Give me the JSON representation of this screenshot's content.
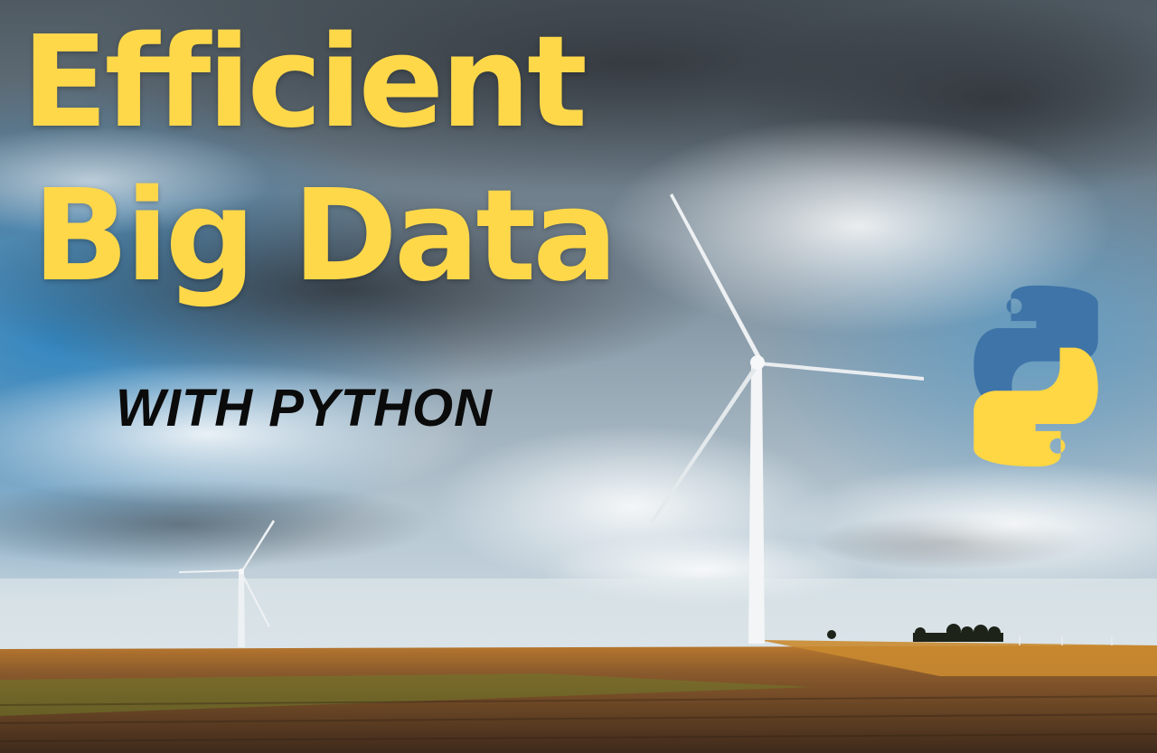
{
  "title": {
    "line1": "Efficient",
    "line2": "Big Data"
  },
  "subtitle": "WITH PYTHON",
  "logo": {
    "icon": "python-logo-icon",
    "colors": {
      "blue": "#3f74a8",
      "yellow": "#ffd644"
    }
  },
  "colors": {
    "title": "#ffd84a",
    "subtitle": "#0b0b0b",
    "sky_blue": "#3d87b8",
    "field": "#6e4a2a"
  }
}
